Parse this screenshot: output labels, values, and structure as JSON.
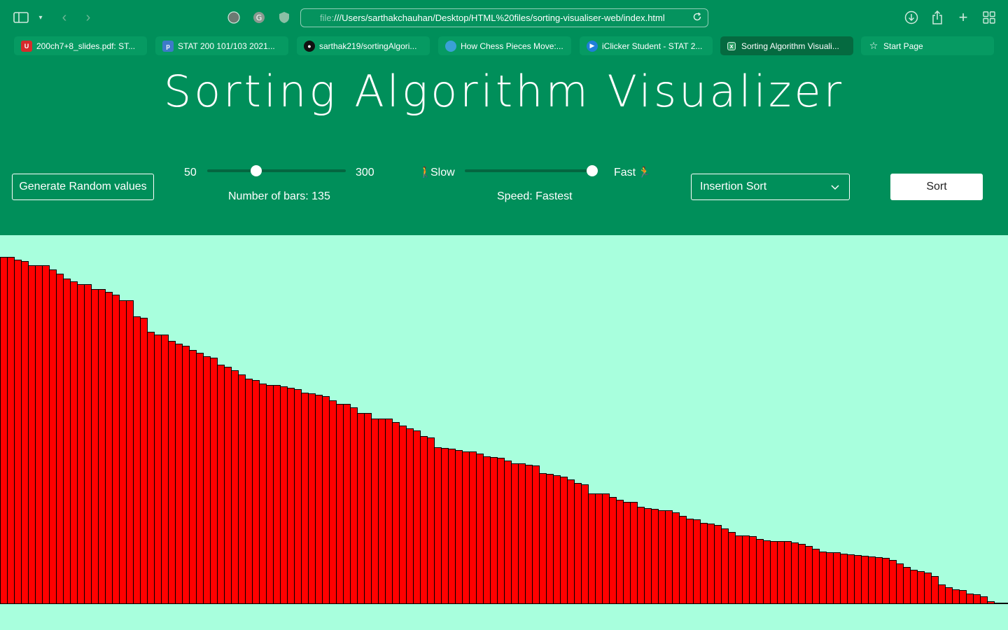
{
  "browser": {
    "url_dim": "file:",
    "url_main": "///Users/sarthakchauhan/Desktop/HTML%20files/sorting-visualiser-web/index.html",
    "tabs": [
      {
        "label": "200ch7+8_slides.pdf: ST...",
        "icon": "ubc-icon",
        "color": "#d62b2b"
      },
      {
        "label": "STAT 200 101/103 2021...",
        "icon": "piazza-icon",
        "color": "#3d7ac9"
      },
      {
        "label": "sarthak219/sortingAlgori...",
        "icon": "github-icon",
        "color": "#111111"
      },
      {
        "label": "How Chess Pieces Move:...",
        "icon": "chess-icon",
        "color": "#3aa0d6"
      },
      {
        "label": "iClicker Student - STAT 2...",
        "icon": "iclicker-icon",
        "color": "#1f7fd9"
      },
      {
        "label": "Sorting Algorithm Visuali...",
        "icon": "page-icon",
        "color": "#2e9e66"
      },
      {
        "label": "Start Page",
        "icon": "star-icon",
        "color": "#ffffff"
      }
    ]
  },
  "app": {
    "title": "Sorting Algorithm Visualizer",
    "generate_label": "Generate Random values",
    "bars_min": "50",
    "bars_max": "300",
    "bars_caption": "Number of bars: 135",
    "bars_value": 135,
    "slow_label": "Slow",
    "fast_label": "Fast",
    "speed_caption": "Speed: Fastest",
    "speed_fraction": 1.0,
    "algorithm_selected": "Insertion Sort",
    "sort_label": "Sort"
  },
  "colors": {
    "header": "#008f5a",
    "background": "#a8ffdd",
    "bar": "#ff0000"
  },
  "chart_data": {
    "type": "bar",
    "order": "descending",
    "count": 135,
    "values": [
      496,
      496,
      492,
      490,
      484,
      484,
      484,
      478,
      472,
      465,
      461,
      457,
      457,
      450,
      450,
      446,
      442,
      434,
      434,
      411,
      409,
      389,
      385,
      385,
      376,
      372,
      369,
      363,
      359,
      354,
      352,
      342,
      339,
      334,
      328,
      322,
      320,
      315,
      313,
      313,
      311,
      309,
      307,
      302,
      301,
      299,
      297,
      291,
      286,
      286,
      281,
      273,
      273,
      265,
      265,
      265,
      260,
      255,
      251,
      248,
      240,
      238,
      224,
      223,
      222,
      220,
      218,
      218,
      215,
      211,
      210,
      209,
      205,
      201,
      201,
      199,
      198,
      187,
      186,
      184,
      182,
      178,
      173,
      171,
      158,
      158,
      158,
      153,
      149,
      146,
      146,
      139,
      137,
      136,
      134,
      134,
      131,
      126,
      122,
      121,
      116,
      115,
      113,
      108,
      103,
      98,
      98,
      97,
      93,
      91,
      90,
      90,
      90,
      88,
      86,
      83,
      79,
      75,
      74,
      74,
      72,
      71,
      70,
      69,
      68,
      67,
      66,
      63,
      58,
      53,
      49,
      47,
      45,
      40,
      28,
      24,
      21,
      20,
      15,
      14,
      11,
      4,
      2,
      1
    ]
  }
}
